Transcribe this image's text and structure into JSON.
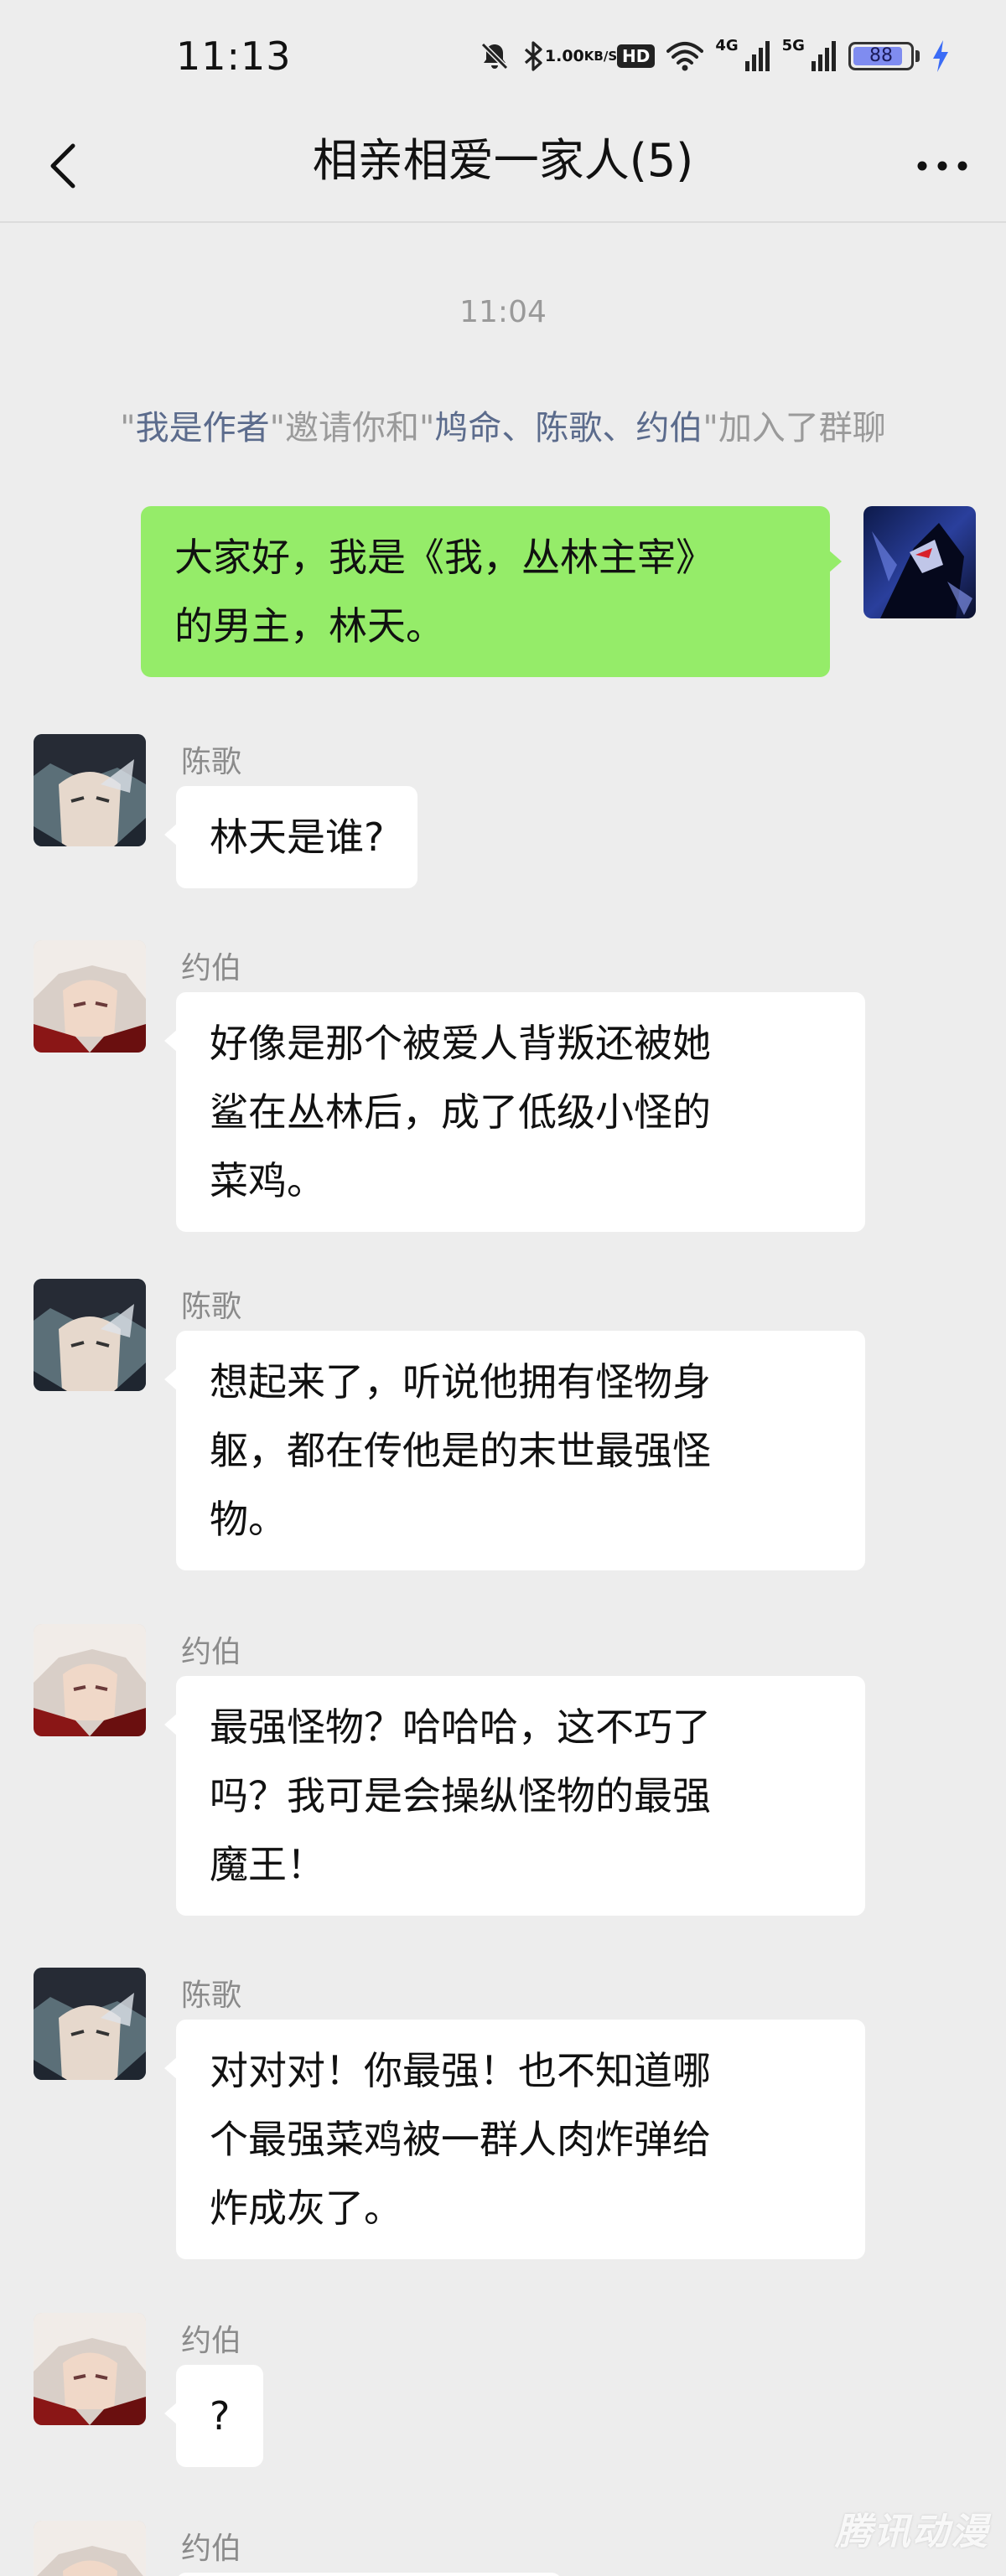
{
  "status_bar": {
    "time": "11:13",
    "speed_value": "1.00",
    "speed_unit": "KB/S",
    "hd_label": "HD",
    "net1_label": "4G",
    "net2_label": "5G",
    "battery_level": 88,
    "battery_text": "88",
    "battery_color": "#7f8cf0",
    "charging_color": "#3b6cf6",
    "icons": [
      "mute-bell-icon",
      "bluetooth-icon",
      "wifi-icon",
      "signal-icon",
      "signal-icon",
      "battery-icon",
      "charging-bolt-icon"
    ]
  },
  "header": {
    "title": "相亲相爱一家人(5)",
    "back_icon": "chevron-left-icon",
    "more_icon": "more-dots-icon"
  },
  "timestamp": "11:04",
  "system_message": {
    "q1": "\"",
    "inviter": "我是作者",
    "q2": "\"",
    "mid": "邀请你和",
    "q3": "\"",
    "invitees": "鸠命、陈歌、约伯",
    "q4": "\"",
    "tail": "加入了群聊"
  },
  "messages": [
    {
      "sender": "",
      "side": "out",
      "text": "大家好，我是《我，丛林主宰》\n的男主，林天。"
    },
    {
      "sender": "陈歌",
      "side": "in",
      "text": "林天是谁?"
    },
    {
      "sender": "约伯",
      "side": "in",
      "text": "好像是那个被爱人背叛还被她\n鲨在丛林后，成了低级小怪的\n菜鸡。"
    },
    {
      "sender": "陈歌",
      "side": "in",
      "text": "想起来了，听说他拥有怪物身\n躯，都在传他是的末世最强怪\n物。"
    },
    {
      "sender": "约伯",
      "side": "in",
      "text": "最强怪物？哈哈哈，这不巧了\n吗？我可是会操纵怪物的最强\n魔王！"
    },
    {
      "sender": "陈歌",
      "side": "in",
      "text": "对对对！你最强！也不知道哪\n个最强菜鸡被一群人肉炸弹给\n炸成灰了。"
    },
    {
      "sender": "约伯",
      "side": "in",
      "text": "?"
    },
    {
      "sender": "约伯",
      "side": "in",
      "text": ""
    }
  ],
  "watermark": "腾讯动漫",
  "colors": {
    "background": "#ededed",
    "bubble_out": "#95ec69",
    "bubble_in": "#ffffff",
    "name_link": "#5b6b8c",
    "meta_text": "#9a9a9a"
  }
}
